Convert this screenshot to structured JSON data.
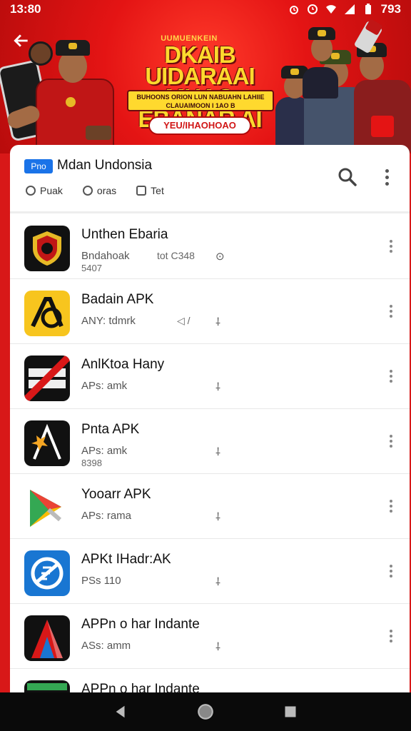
{
  "status_bar": {
    "time": "13:80",
    "battery": "793"
  },
  "banner": {
    "small_text": "UUMUENKEIN",
    "title": "DKAIB UIDARAAI MHAO EBANAR AI",
    "subtitle": "BUHOONS ORION LUN NABUAHN LAHIIE CLAUAIMOON I 1AO B",
    "button": "YEU/IHAOHOAO"
  },
  "header": {
    "tag": "Pno",
    "title": "Mdan Undonsia",
    "filters": [
      {
        "label": "Puak",
        "icon": "circle-icon"
      },
      {
        "label": "oras",
        "icon": "clock-icon"
      },
      {
        "label": "Tet",
        "icon": "square-icon"
      }
    ]
  },
  "apps": [
    {
      "name": "Unthen Ebaria",
      "sub": "Bndahoak",
      "meta": "tot C348",
      "glyph": "⊙",
      "sub2": "5407",
      "icon": "emblem-icon"
    },
    {
      "name": "Badain APK",
      "sub": "ANY: tdmrk",
      "meta": "◁ /",
      "glyph": "⸸",
      "sub2": "",
      "icon": "letter-a-yellow-icon"
    },
    {
      "name": "AnlKtoa Hany",
      "sub": "APs: amk",
      "meta": "",
      "glyph": "⸸",
      "sub2": "",
      "icon": "red-stripe-icon"
    },
    {
      "name": "Pnta APK",
      "sub": "APs: amk",
      "meta": "",
      "glyph": "⸸",
      "sub2": "8398",
      "icon": "star-a-icon"
    },
    {
      "name": "Yooarr APK",
      "sub": "APs: rama",
      "meta": "",
      "glyph": "⸸",
      "sub2": "",
      "icon": "play-triangle-icon"
    },
    {
      "name": "APKt IHadr:AK",
      "sub": "PSs 110",
      "meta": "",
      "glyph": "⸸",
      "sub2": "",
      "icon": "blue-circle-icon"
    },
    {
      "name": "APPn o har Indante",
      "sub": "ASs: amm",
      "meta": "",
      "glyph": "⸸",
      "sub2": "",
      "icon": "red-a-icon"
    },
    {
      "name": "APPn o har Indante",
      "sub": "",
      "meta": "",
      "glyph": "",
      "sub2": "",
      "icon": "green-icon"
    }
  ],
  "colors": {
    "brand": "#d81818",
    "accent": "#1a73e8",
    "banner_gold": "#ffd92e"
  }
}
